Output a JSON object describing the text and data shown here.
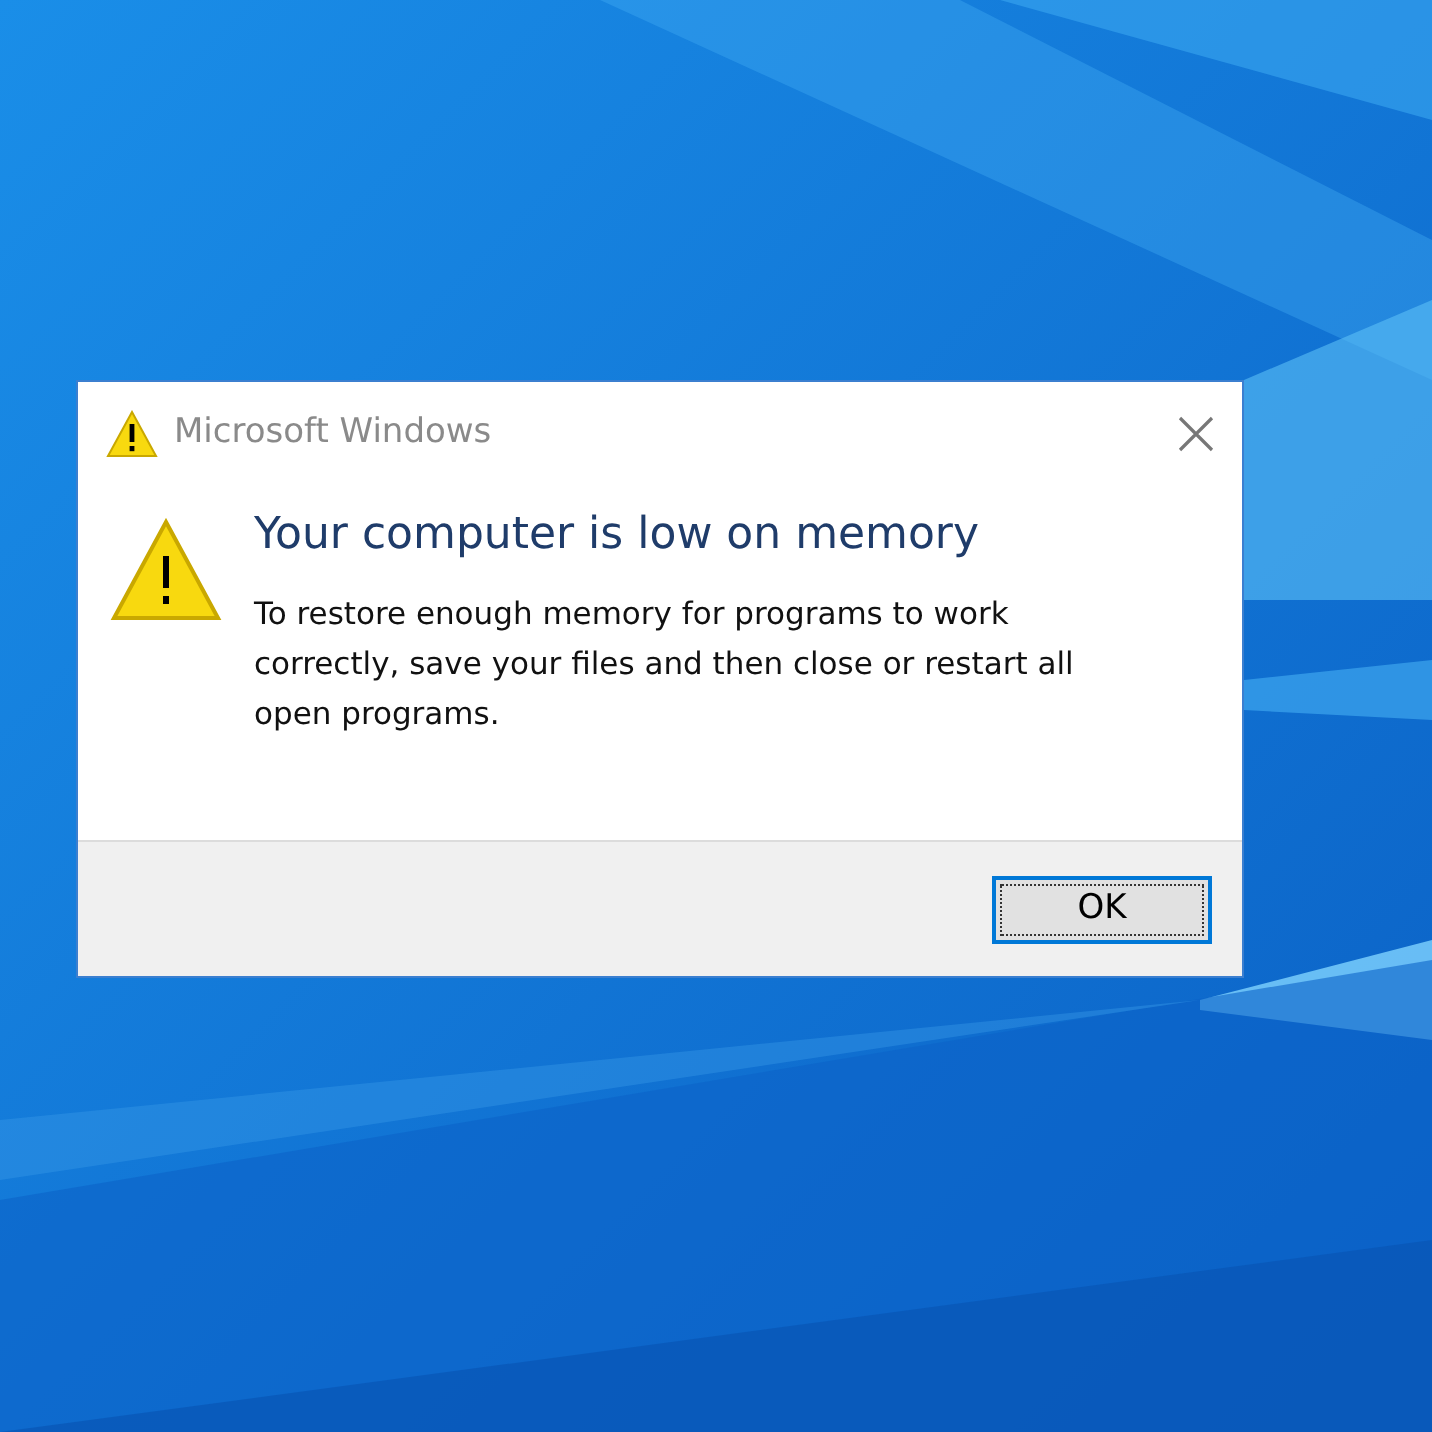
{
  "window": {
    "title": "Microsoft Windows"
  },
  "message": {
    "heading": "Your computer is low on memory",
    "body": "To restore enough memory for programs to work correctly, save your files and then close or restart all open programs."
  },
  "buttons": [
    {
      "label": "OK",
      "default": true
    }
  ]
}
